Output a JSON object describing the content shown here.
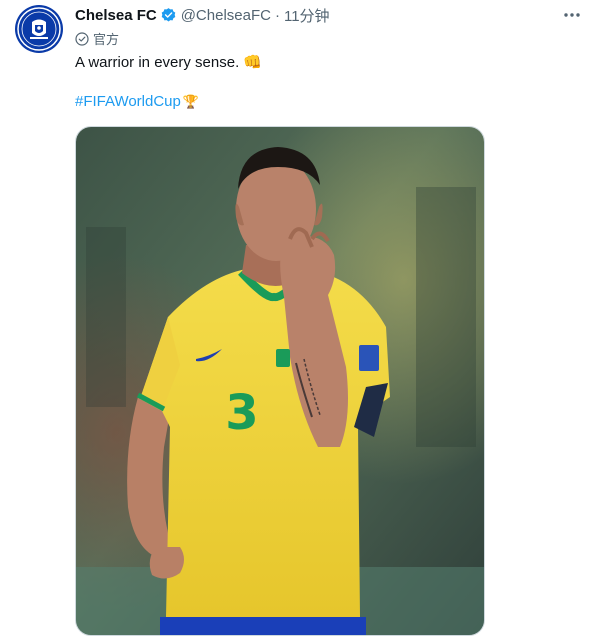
{
  "post": {
    "author_name": "Chelsea FC",
    "handle": "@ChelseaFC",
    "separator": "·",
    "time": "11分钟",
    "official_label": "官方",
    "text": "A warrior in every sense.",
    "text_emoji": "👊",
    "hashtag": "#FIFAWorldCup",
    "hashtag_emoji": "🏆",
    "jersey_number": "3"
  },
  "icons": {
    "avatar": "chelsea-crest-icon",
    "verified": "verified-badge-icon",
    "more": "more-icon",
    "official": "official-check-icon"
  },
  "colors": {
    "link": "#1d9bf0",
    "verified": "#1d9bf0",
    "secondary_text": "#536471",
    "crest_blue": "#0a3aa8",
    "jersey_yellow": "#f1d43a",
    "jersey_green": "#1a9b59",
    "shorts_blue": "#1a3fb8"
  }
}
